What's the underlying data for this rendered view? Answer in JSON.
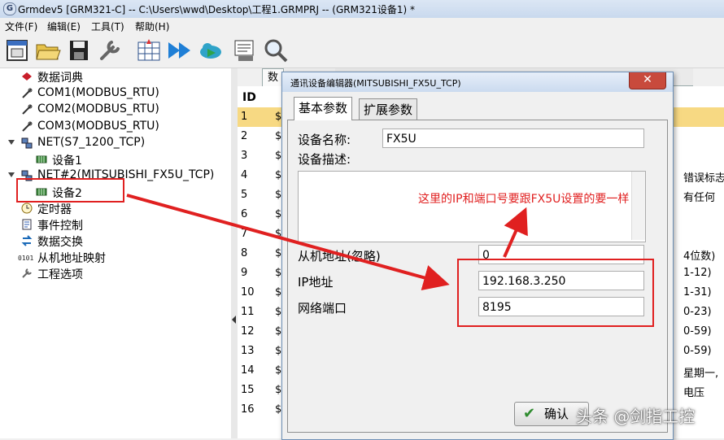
{
  "window": {
    "title": "Grmdev5 [GRM321-C]  -- C:\\Users\\wwd\\Desktop\\工程1.GRMPRJ -- (GRM321设备1) *",
    "icon_letter": "G"
  },
  "menu": [
    "文件(F)",
    "编辑(E)",
    "工具(T)",
    "帮助(H)"
  ],
  "toolbar": [
    "new-project-icon",
    "open-folder-icon",
    "save-icon",
    "wrench-icon",
    "grid-config-icon",
    "fast-forward-icon",
    "cloud-sync-icon",
    "monitor-icon",
    "search-icon"
  ],
  "tree": {
    "items": [
      {
        "label": "数据词典",
        "icon": "book-icon"
      },
      {
        "label": "COM1(MODBUS_RTU)",
        "icon": "serial-port-icon"
      },
      {
        "label": "COM2(MODBUS_RTU)",
        "icon": "serial-port-icon"
      },
      {
        "label": "COM3(MODBUS_RTU)",
        "icon": "serial-port-icon"
      },
      {
        "label": "NET(S7_1200_TCP)",
        "icon": "network-icon"
      },
      {
        "label": "设备1",
        "icon": "device-icon"
      },
      {
        "label": "NET#2(MITSUBISHI_FX5U_TCP)",
        "icon": "network-icon"
      },
      {
        "label": "设备2",
        "icon": "device-icon"
      },
      {
        "label": "定时器",
        "icon": "clock-icon"
      },
      {
        "label": "事件控制",
        "icon": "event-icon"
      },
      {
        "label": "数据交换",
        "icon": "exchange-icon"
      },
      {
        "label": "从机地址映射",
        "icon": "binary-icon"
      },
      {
        "label": "工程选项",
        "icon": "tools-icon"
      }
    ]
  },
  "grid": {
    "tab": "数",
    "header_id": "ID",
    "rows": [
      {
        "id": "1",
        "tail": ""
      },
      {
        "id": "2",
        "tail": ""
      },
      {
        "id": "3",
        "tail": ""
      },
      {
        "id": "4",
        "tail": "错误标志"
      },
      {
        "id": "5",
        "tail": "有任何"
      },
      {
        "id": "6",
        "tail": ""
      },
      {
        "id": "7",
        "tail": ""
      },
      {
        "id": "8",
        "tail": "4位数)"
      },
      {
        "id": "9",
        "tail": "1-12)"
      },
      {
        "id": "10",
        "tail": "1-31)"
      },
      {
        "id": "11",
        "tail": "0-23)"
      },
      {
        "id": "12",
        "tail": "0-59)"
      },
      {
        "id": "13",
        "tail": "0-59)"
      },
      {
        "id": "14",
        "tail": "星期一,"
      },
      {
        "id": "15",
        "tail": "电压"
      },
      {
        "id": "16",
        "tail": ""
      }
    ]
  },
  "dialog": {
    "title": "通讯设备编辑器(MITSUBISHI_FX5U_TCP)",
    "close": "✕",
    "tabs": [
      "基本参数",
      "扩展参数"
    ],
    "device_name_label": "设备名称:",
    "device_name_value": "FX5U",
    "device_desc_label": "设备描述:",
    "slave_addr_label": "从机地址(忽略)",
    "slave_addr_value": "0",
    "ip_label": "IP地址",
    "ip_value": "192.168.3.250",
    "port_label": "网络端口",
    "port_value": "8195",
    "ok_label": "确认"
  },
  "annotation": "这里的IP和端口号要跟FX5U设置的要一样",
  "watermark": "头条 @剑指工控",
  "colors": {
    "highlight": "#e02020",
    "selected_row": "#f7d983",
    "accent": "#2b6cb5"
  }
}
